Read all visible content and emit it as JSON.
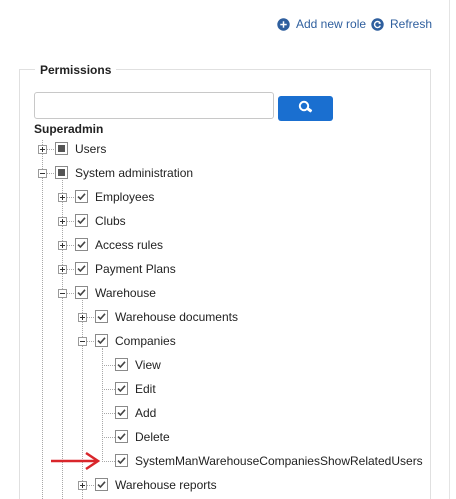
{
  "toolbar": {
    "add_role_label": "Add new role",
    "refresh_label": "Refresh",
    "accent_color": "#2f5f9e"
  },
  "permissions": {
    "section_title": "Permissions",
    "search": {
      "value": "",
      "placeholder": ""
    },
    "root_label": "Superadmin",
    "items": [
      {
        "label": "Users",
        "state": "partial",
        "expander": "plus"
      },
      {
        "label": "System administration",
        "state": "partial",
        "expander": "minus"
      },
      {
        "label": "Employees",
        "state": "checked",
        "expander": "plus"
      },
      {
        "label": "Clubs",
        "state": "checked",
        "expander": "plus"
      },
      {
        "label": "Access rules",
        "state": "checked",
        "expander": "plus"
      },
      {
        "label": "Payment Plans",
        "state": "checked",
        "expander": "plus"
      },
      {
        "label": "Warehouse",
        "state": "checked",
        "expander": "minus"
      },
      {
        "label": "Warehouse documents",
        "state": "checked",
        "expander": "plus"
      },
      {
        "label": "Companies",
        "state": "checked",
        "expander": "minus"
      },
      {
        "label": "View",
        "state": "checked",
        "expander": "none"
      },
      {
        "label": "Edit",
        "state": "checked",
        "expander": "none"
      },
      {
        "label": "Add",
        "state": "checked",
        "expander": "none"
      },
      {
        "label": "Delete",
        "state": "checked",
        "expander": "none"
      },
      {
        "label": "SystemManWarehouseCompaniesShowRelatedUsers",
        "state": "checked",
        "expander": "none"
      },
      {
        "label": "Warehouse reports",
        "state": "checked",
        "expander": "plus"
      }
    ]
  },
  "annotation": {
    "arrow_color": "#d9262b"
  },
  "search_button_color": "#1a6fd0"
}
